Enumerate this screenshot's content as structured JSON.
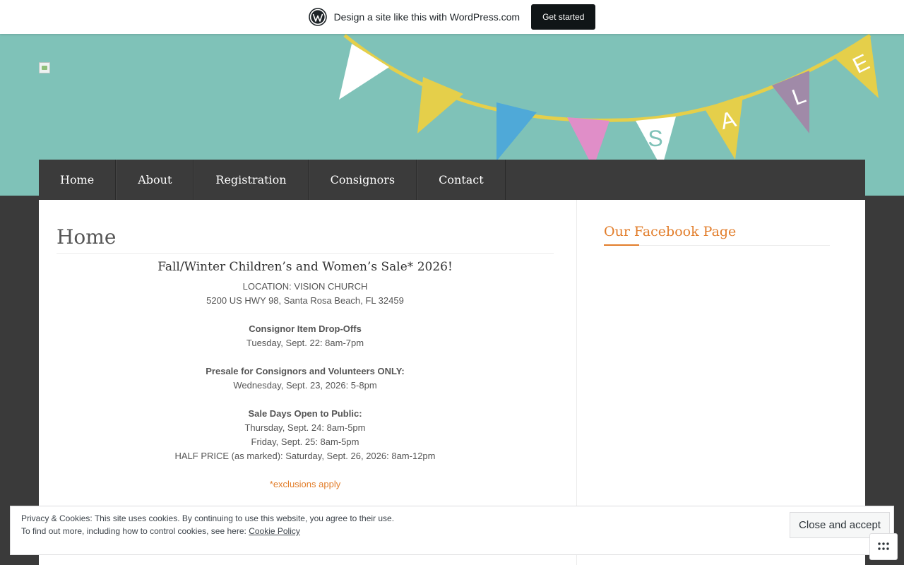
{
  "wpbar": {
    "text": "Design a site like this with WordPress.com",
    "button": "Get started"
  },
  "bunting": {
    "letters": [
      "S",
      "A",
      "L",
      "E"
    ],
    "colors": {
      "string": "#e5cf4a",
      "white": "#ffffff",
      "yellow": "#e5cf4a",
      "blue": "#4fa9d8",
      "pink": "#e08ec8",
      "purple": "#a08aa8",
      "teal_letter": "#7fc2b8"
    }
  },
  "nav": {
    "items": [
      "Home",
      "About",
      "Registration",
      "Consignors",
      "Contact"
    ]
  },
  "main": {
    "title": "Home",
    "event_heading": "Fall/Winter Children’s and Women’s Sale* 2026!",
    "location_label": "LOCATION: VISION CHURCH",
    "address": "5200 US HWY 98, Santa Rosa Beach, FL 32459",
    "dropoff_heading": "Consignor Item Drop-Offs",
    "dropoff_time": "Tuesday, Sept. 22: 8am-7pm",
    "presale_heading": "Presale for Consignors and Volunteers ONLY:",
    "presale_time": "Wednesday, Sept. 23, 2026: 5-8pm",
    "public_heading": "Sale Days Open to Public:",
    "public_day1": "Thursday, Sept. 24: 8am-5pm",
    "public_day2": "Friday, Sept. 25: 8am-5pm",
    "public_day3": "HALF PRICE (as marked): Saturday, Sept. 26, 2026: 8am-12pm",
    "exclusions": "*exclusions apply"
  },
  "sidebar": {
    "widget_title": "Our Facebook Page"
  },
  "cookie": {
    "line1": "Privacy & Cookies: This site uses cookies. By continuing to use this website, you agree to their use.",
    "line2_prefix": "To find out more, including how to control cookies, see here: ",
    "link": "Cookie Policy",
    "button": "Close and accept"
  },
  "colors": {
    "header_bg": "#7fc2b8",
    "nav_bg": "#3b3b3b",
    "accent": "#e27d2a",
    "page_bg": "#3a3a3a"
  }
}
